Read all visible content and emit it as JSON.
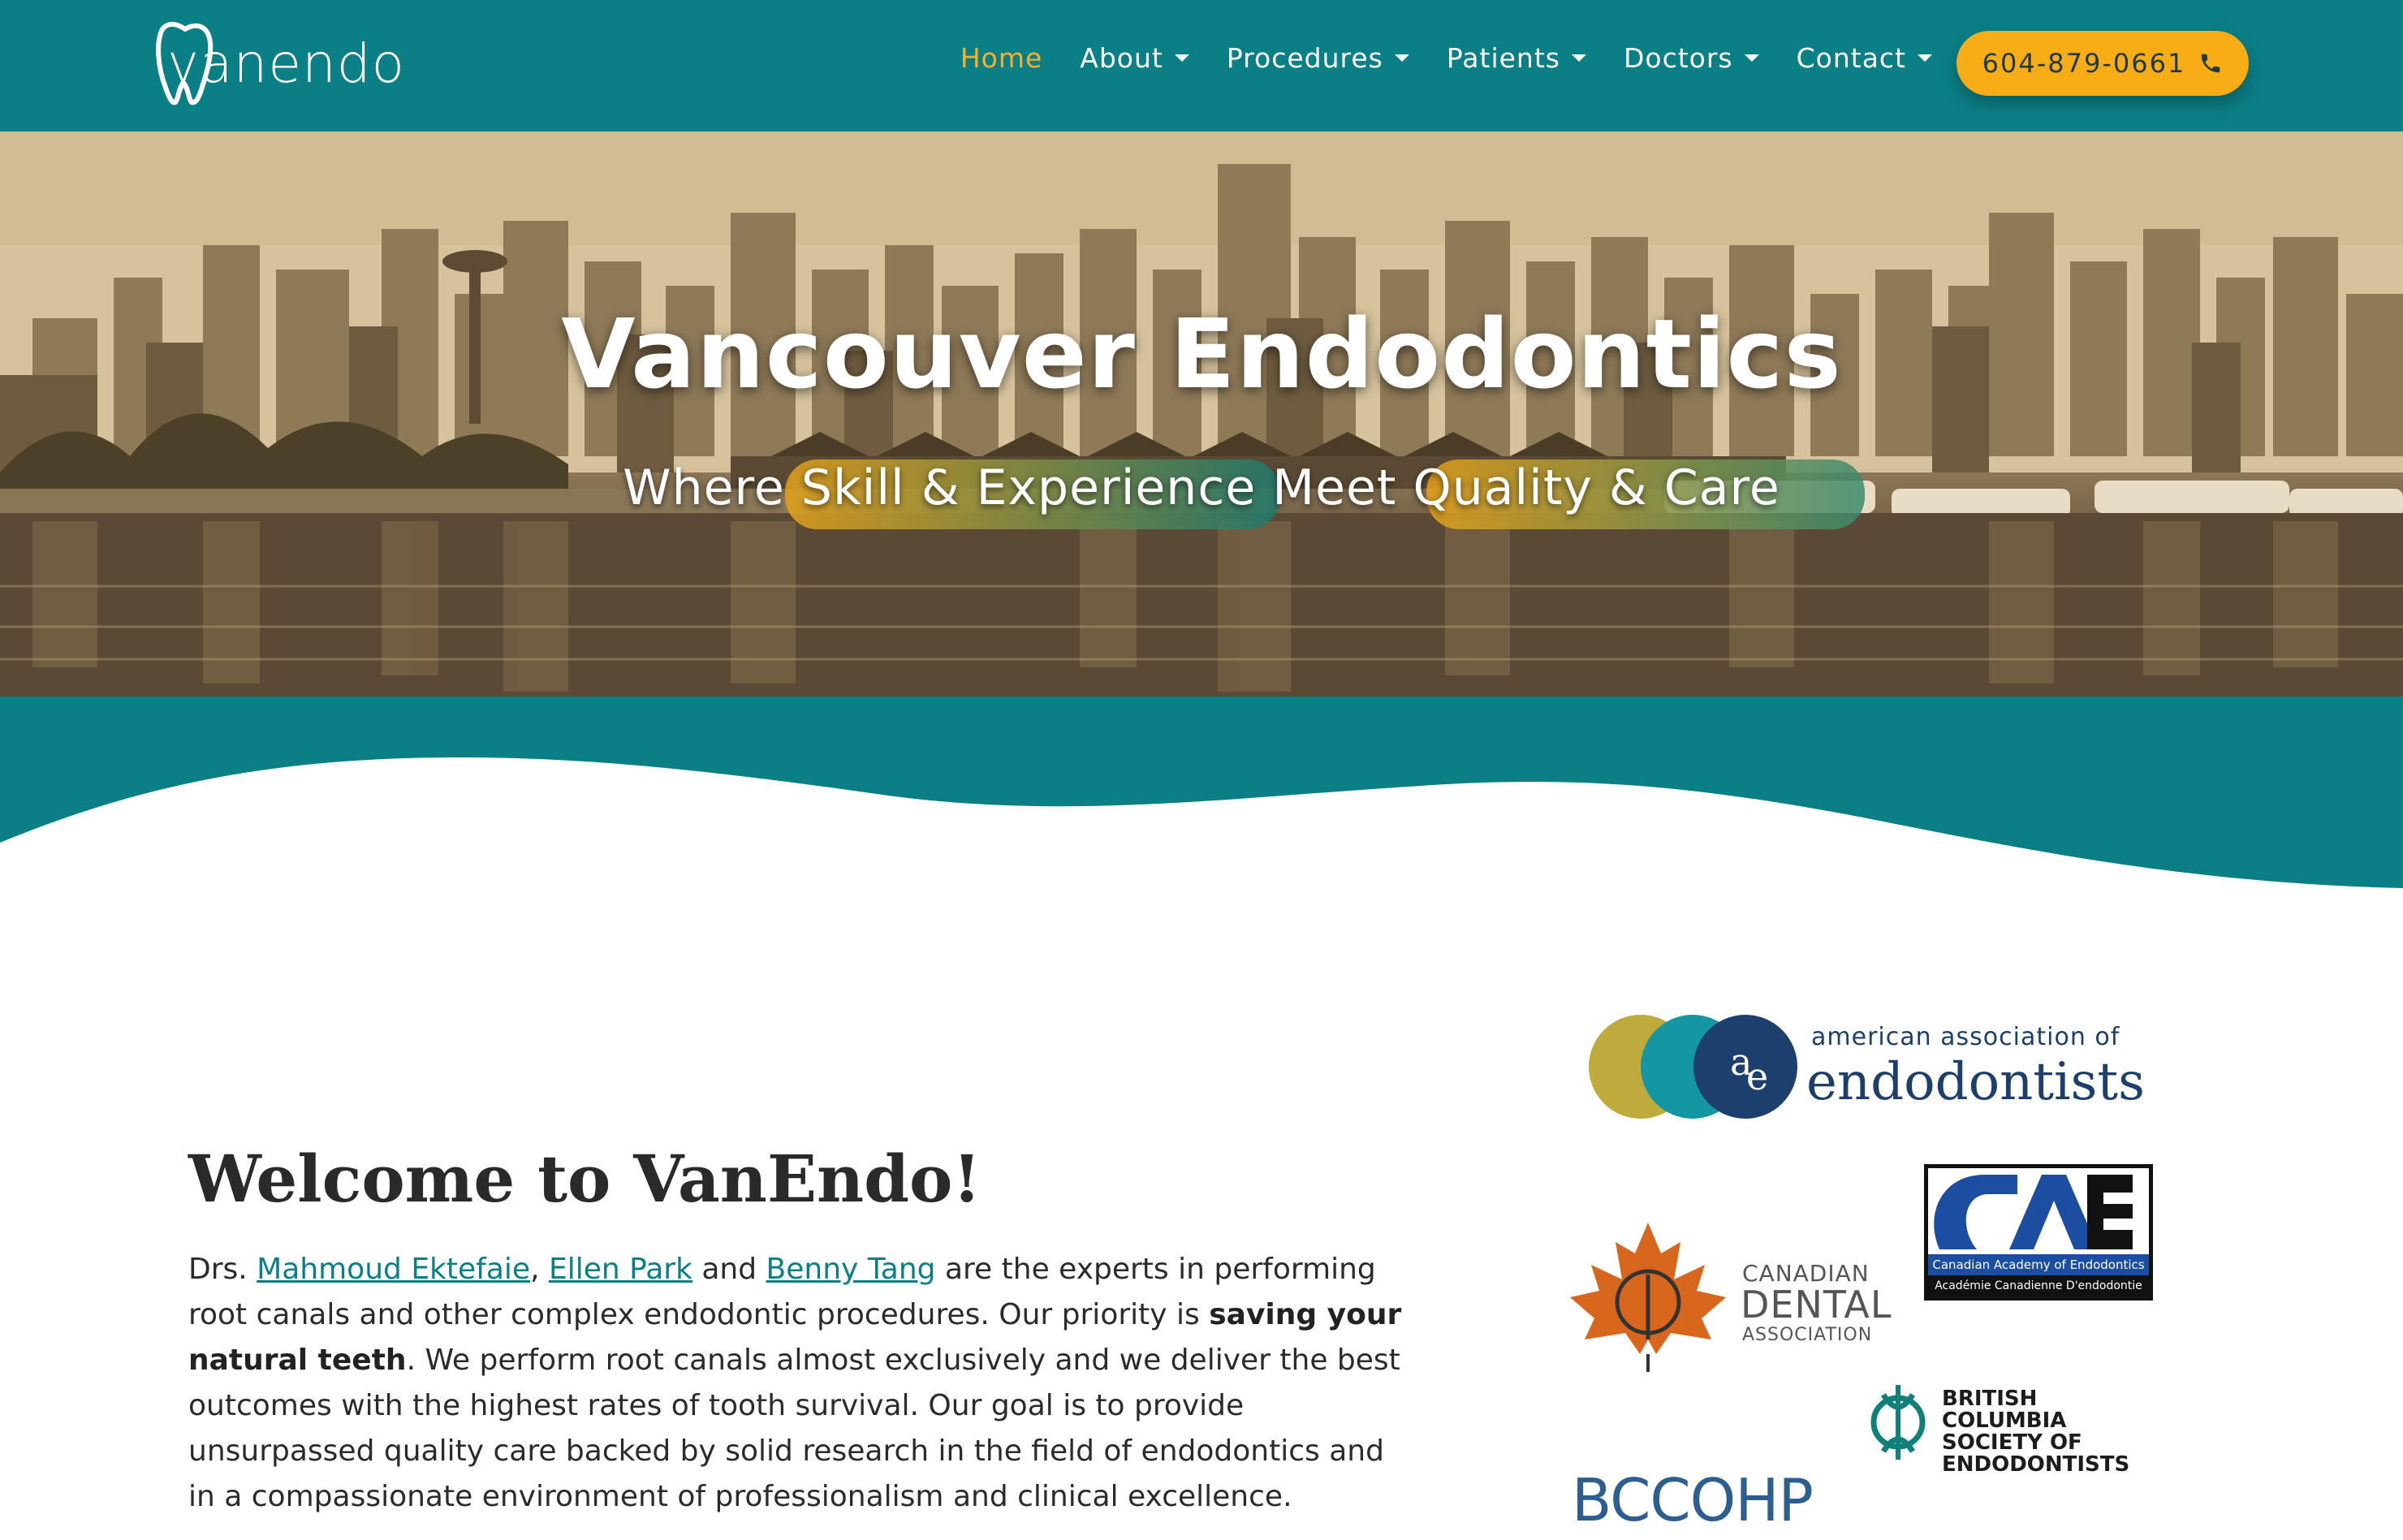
{
  "header": {
    "logo_text": "vanendo",
    "nav": [
      {
        "label": "Home",
        "active": true,
        "dropdown": false
      },
      {
        "label": "About",
        "active": false,
        "dropdown": true
      },
      {
        "label": "Procedures",
        "active": false,
        "dropdown": true
      },
      {
        "label": "Patients",
        "active": false,
        "dropdown": true
      },
      {
        "label": "Doctors",
        "active": false,
        "dropdown": true
      },
      {
        "label": "Contact",
        "active": false,
        "dropdown": true
      }
    ],
    "phone": "604-879-0661",
    "phone_icon": "phone-icon"
  },
  "hero": {
    "title": "Vancouver Endodontics",
    "subtitle": "Where Skill & Experience Meet Quality & Care"
  },
  "welcome": {
    "title": "Welcome to VanEndo!",
    "prefix": "Drs. ",
    "doctor1": "Mahmoud Ektefaie",
    "sep1": ", ",
    "doctor2": "Ellen Park",
    "sep2": " and ",
    "doctor3": "Benny Tang",
    "text1": " are the experts in performing root canals and other complex endodontic procedures. Our priority is ",
    "bold": "saving your natural teeth",
    "text2": ". We perform root canals almost exclusively and we deliver the best outcomes with the highest rates of tooth survival. Our goal is to provide unsurpassed quality care backed by solid research in the field of endodontics and in a compassionate environment of professionalism and clinical excellence."
  },
  "affiliations": {
    "aae": {
      "line1": "american association of",
      "line2": "endodontists"
    },
    "cda": {
      "line1": "CANADIAN",
      "line2": "DENTAL",
      "line3": "ASSOCIATION"
    },
    "cae": {
      "line1": "Canadian Academy of Endodontics",
      "line2": "Académie Canadienne D'endodontie"
    },
    "bcse": {
      "line1": "BRITISH COLUMBIA",
      "line2": "SOCIETY OF",
      "line3": "ENDODONTISTS"
    },
    "bccohp": {
      "label": "BCCOHP"
    }
  },
  "colors": {
    "teal": "#0b7f86",
    "accent_orange": "#f8ac16",
    "active_nav": "#f6b12c"
  }
}
